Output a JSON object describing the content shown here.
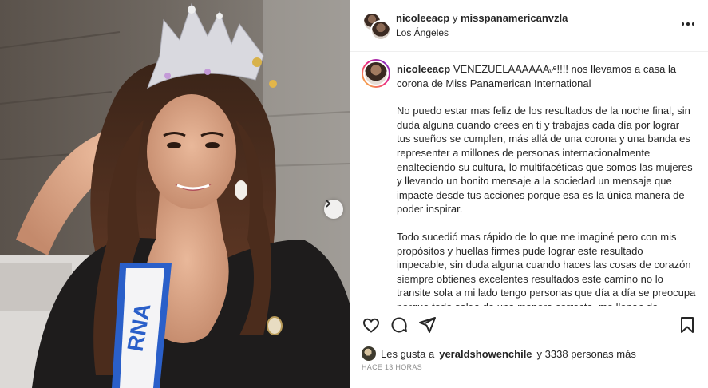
{
  "post": {
    "owner": "nicoleeacp",
    "conjunction": "y",
    "collaborator": "misspanamericanvzla",
    "location": "Los Ángeles",
    "caption": {
      "username": "nicoleeacp",
      "headline": "VENEZUELAAAAAAᵥᵉ!!!! nos llevamos a casa la corona de Miss Panamerican International",
      "paragraph_1": "No puedo estar mas feliz de los resultados de la noche final, sin duda alguna cuando crees en ti y trabajas cada día por lograr tus sueños se cumplen, más allá de una corona y una banda es representer a millones de personas internacionalmente enalteciendo su cultura, lo multifacéticas que somos las mujeres y llevando un bonito mensaje a la sociedad un mensaje que impacte desde tus acciones porque esa es la única manera de poder inspirar.",
      "paragraph_2": "Todo sucedió mas rápido de lo que me imaginé pero con mis propósitos y huellas firmes pude lograr este resultado impecable, sin duda alguna cuando haces las cosas de corazón siempre obtienes excelentes resultados este camino no lo transite sola a mi lado tengo personas que día a día se preocupa porque todo salga de una manera correcta, me llenan de valentía y mucho pasión por cada cosa que me proponga por eso quiero"
    },
    "likes": {
      "prefix": "Les gusta a",
      "user": "yeraldshowenchile",
      "suffix": "y 3338 personas más"
    },
    "timestamp": "HACE 13 HORAS"
  },
  "icons": {
    "more": "more-horizontal-icon",
    "like": "heart-icon",
    "comment": "comment-icon",
    "share": "send-icon",
    "save": "bookmark-icon",
    "carousel_next": "chevron-right-icon"
  },
  "colors": {
    "text": "#262626",
    "secondary": "#8e8e8e",
    "border": "#dbdbdb",
    "sash": "#2a5fc9"
  }
}
